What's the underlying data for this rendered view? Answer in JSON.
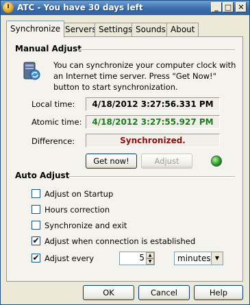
{
  "window": {
    "title": "ATC - You have 30 days left",
    "minimize_glyph": "_",
    "maximize_glyph": "□",
    "close_glyph": "✕"
  },
  "tabs": [
    {
      "label": "Synchronize",
      "active": true
    },
    {
      "label": "Servers",
      "active": false
    },
    {
      "label": "Settings",
      "active": false
    },
    {
      "label": "Sounds",
      "active": false
    },
    {
      "label": "About",
      "active": false
    }
  ],
  "manual_adjust": {
    "title": "Manual Adjust",
    "description": "You can synchronize your computer clock with an Internet time server. Press \"Get Now!\" button to start synchronization.",
    "local_time_label": "Local time:",
    "local_time_value": "4/18/2012 3:27:56.331 PM",
    "atomic_time_label": "Atomic time:",
    "atomic_time_value": "4/18/2012 3:27:55.927 PM",
    "difference_label": "Difference:",
    "difference_value": "Synchronized.",
    "get_now_label": "Get now!",
    "adjust_label": "Adjust",
    "colors": {
      "local": "#1a1a1a",
      "atomic": "#1f7a1f",
      "difference": "#8a1010"
    }
  },
  "auto_adjust": {
    "title": "Auto Adjust",
    "options": [
      {
        "label": "Adjust on Startup",
        "checked": false
      },
      {
        "label": "Hours correction",
        "checked": false
      },
      {
        "label": "Synchronize and exit",
        "checked": false
      },
      {
        "label": "Adjust when connection is established",
        "checked": true
      },
      {
        "label": "Adjust every",
        "checked": true
      }
    ],
    "interval_value": "5",
    "interval_unit": "minutes"
  },
  "footer": {
    "ok_label": "OK",
    "cancel_label": "Cancel",
    "help_label": "Help"
  },
  "icons": {
    "check": "✔",
    "spin_up": "▲",
    "spin_down": "▼",
    "dropdown": "▼"
  }
}
